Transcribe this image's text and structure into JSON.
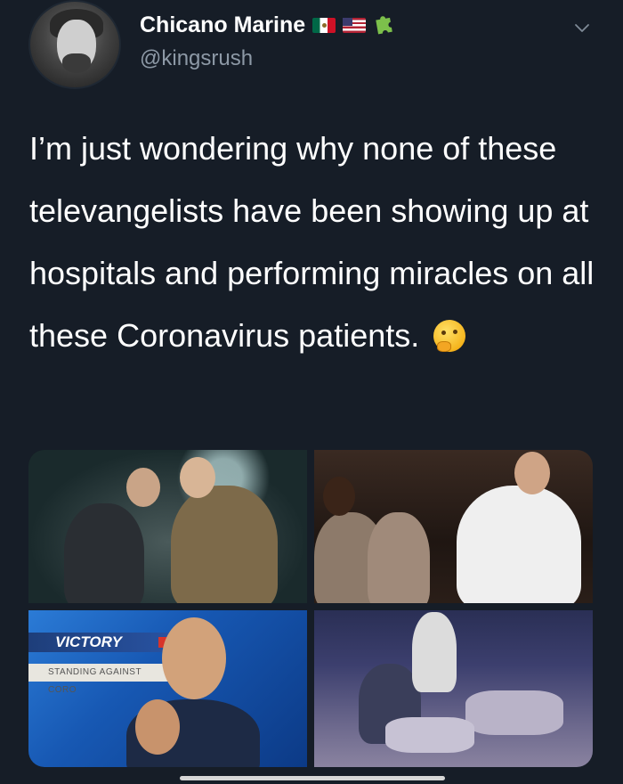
{
  "author": {
    "display_name": "Chicano Marine",
    "handle": "@kingsrush",
    "badges": [
      "mexico-flag",
      "us-flag",
      "puzzle-piece"
    ]
  },
  "tweet": {
    "text": "I’m just wondering why none of these televangelists have been showing up at hospitals and performing miracles on all these Coronavirus patients.",
    "emoji": "thinking-face"
  },
  "media": {
    "photo_3": {
      "banner_text": "VICTORY",
      "ticker_text": "STANDING AGAINST CORO"
    }
  },
  "colors": {
    "background": "#161d27",
    "text": "#ffffff",
    "secondary_text": "#8d99a6",
    "puzzle_green": "#7cc04b"
  }
}
